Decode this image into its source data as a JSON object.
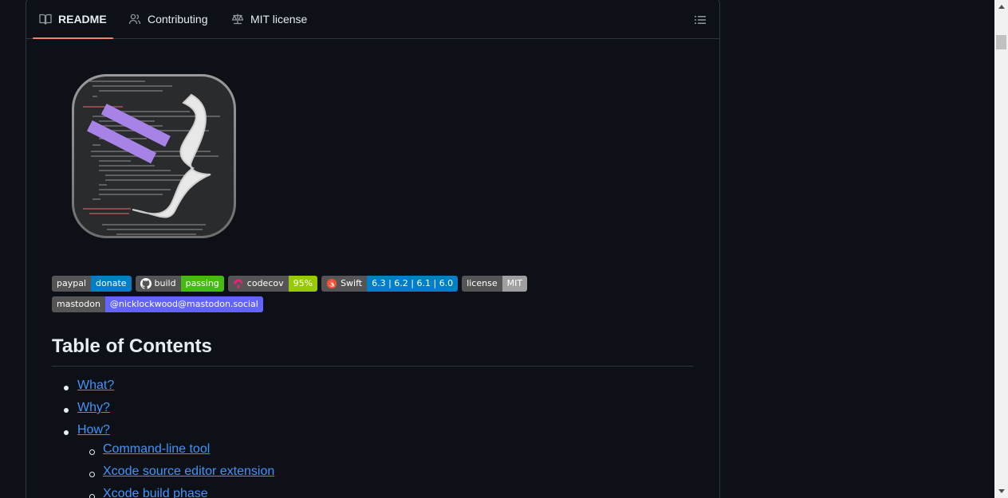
{
  "tabs": {
    "readme": "README",
    "contributing": "Contributing",
    "license": "MIT license"
  },
  "badges": {
    "paypal": {
      "left": "paypal",
      "right": "donate",
      "color": "#007ec6"
    },
    "build": {
      "left": "build",
      "right": "passing",
      "color": "#4c1"
    },
    "codecov": {
      "left": "codecov",
      "right": "95%",
      "color": "#97ca00"
    },
    "swift": {
      "left": "Swift",
      "right": "6.3 | 6.2 | 6.1 | 6.0",
      "color": "#007ec6"
    },
    "license": {
      "left": "license",
      "right": "MIT",
      "color": "#9f9f9f"
    },
    "mastodon": {
      "left": "mastodon",
      "right": "@nicklockwood@mastodon.social",
      "color": "#6364ff"
    }
  },
  "toc": {
    "heading": "Table of Contents",
    "items": [
      "What?",
      "Why?",
      "How?"
    ],
    "subitems": [
      "Command-line tool",
      "Xcode source editor extension",
      "Xcode build phase"
    ]
  },
  "colors": {
    "accent": "#f78166",
    "link": "#4493f8",
    "background": "#0d1117",
    "border": "#30363d"
  }
}
